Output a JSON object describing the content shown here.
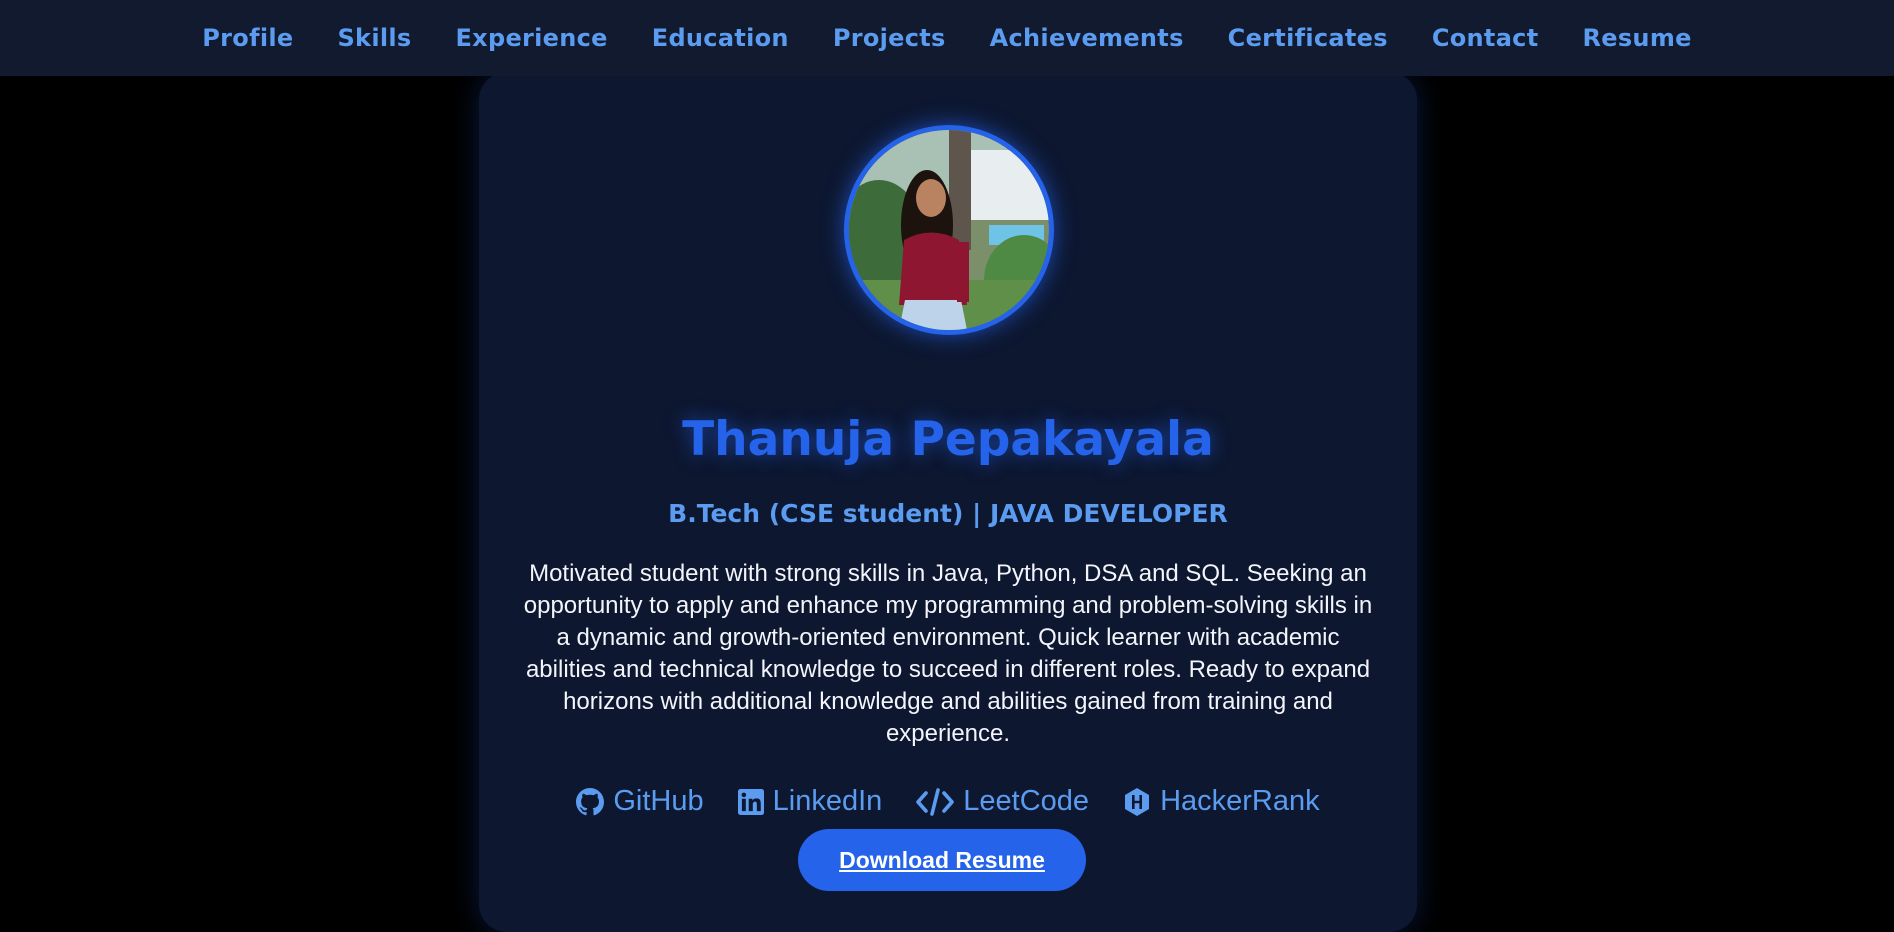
{
  "nav": {
    "items": [
      {
        "label": "Profile"
      },
      {
        "label": "Skills"
      },
      {
        "label": "Experience"
      },
      {
        "label": "Education"
      },
      {
        "label": "Projects"
      },
      {
        "label": "Achievements"
      },
      {
        "label": "Certificates"
      },
      {
        "label": "Contact"
      },
      {
        "label": "Resume"
      }
    ]
  },
  "profile": {
    "name": "Thanuja Pepakayala",
    "subtitle": "B.Tech (CSE student) | JAVA DEVELOPER",
    "bio": "Motivated student with strong skills in Java, Python, DSA and SQL. Seeking an opportunity to apply and enhance my programming and problem-solving skills in a dynamic and growth-oriented environment. Quick learner with academic abilities and technical knowledge to succeed in different roles. Ready to expand horizons with additional knowledge and abilities gained from training and experience."
  },
  "links": [
    {
      "label": "GitHub",
      "icon": "github-icon"
    },
    {
      "label": "LinkedIn",
      "icon": "linkedin-icon"
    },
    {
      "label": "LeetCode",
      "icon": "code-icon"
    },
    {
      "label": "HackerRank",
      "icon": "hackerrank-icon"
    }
  ],
  "resume_button": {
    "label": "Download Resume"
  },
  "colors": {
    "accent": "#2563eb",
    "link": "#5b9cf0",
    "nav_bg": "#111a2e",
    "card_bg": "#0d1730",
    "page_bg": "#000000"
  }
}
